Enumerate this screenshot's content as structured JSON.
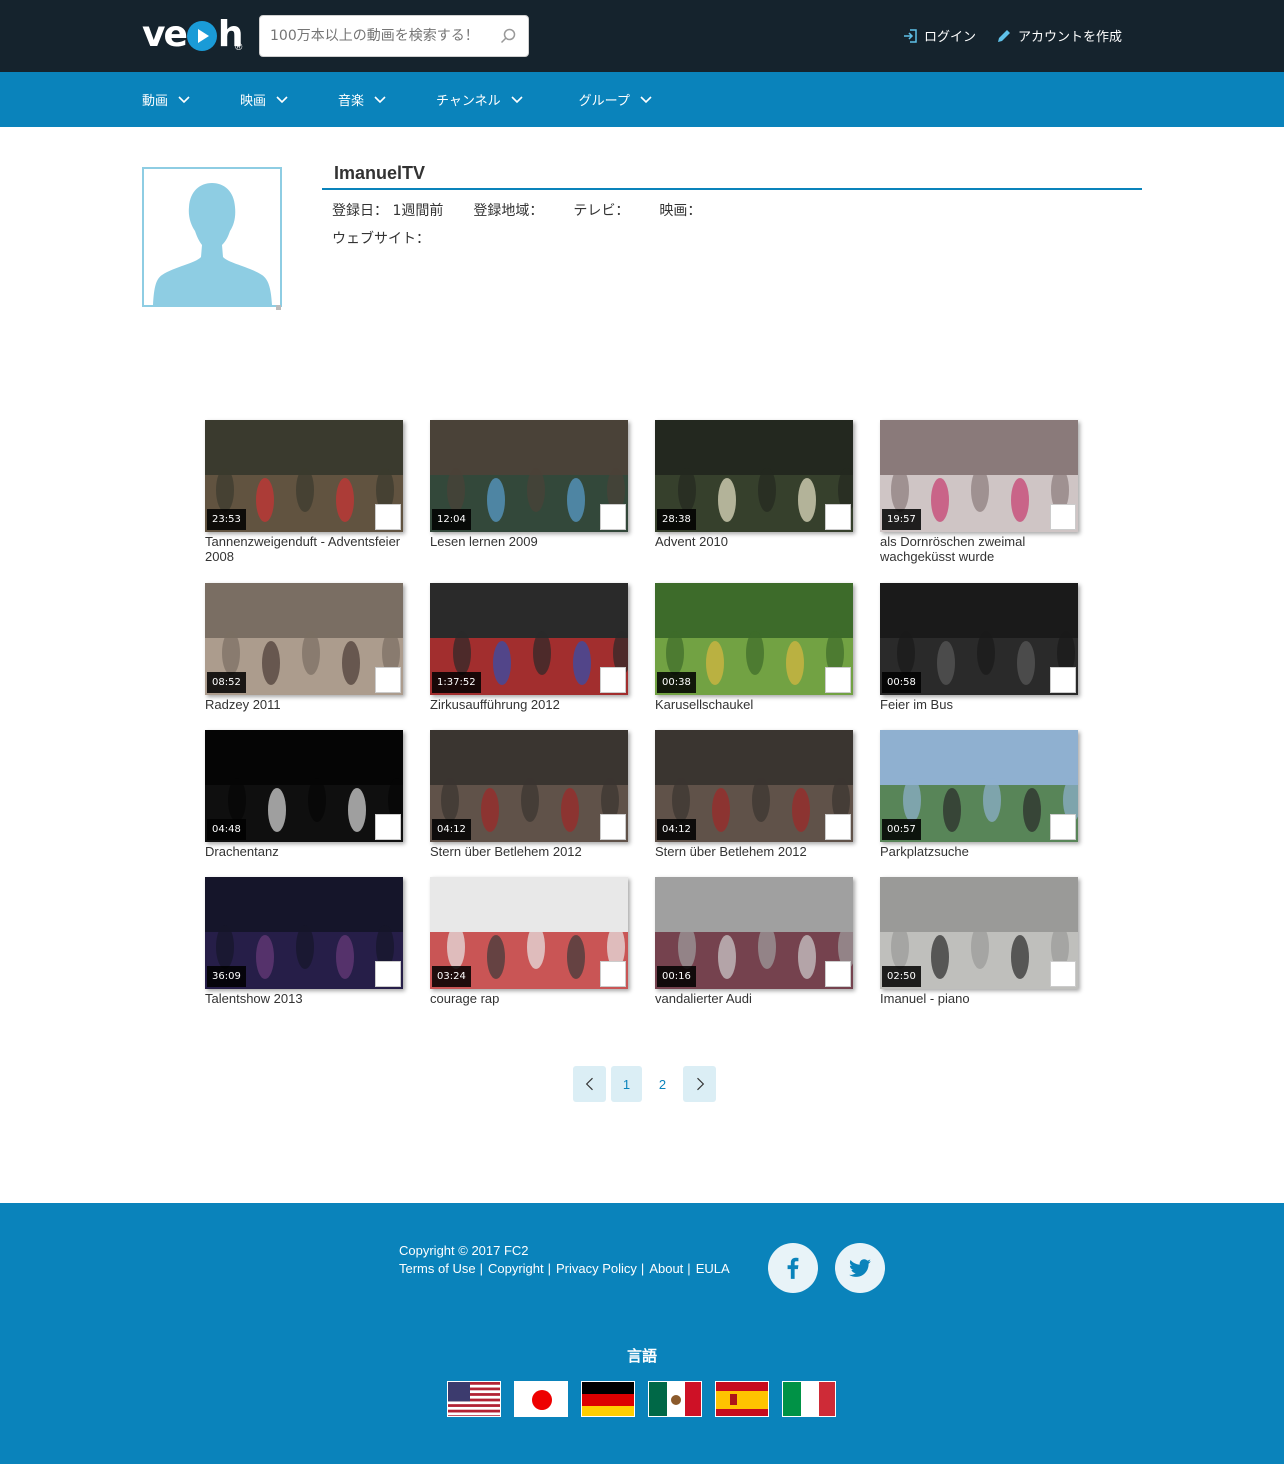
{
  "header": {
    "logo": "veoh",
    "logo_reg": "®",
    "search_placeholder": "100万本以上の動画を検索する！",
    "login_label": "ログイン",
    "signup_label": "アカウントを作成"
  },
  "nav": {
    "items": [
      {
        "label": "動画"
      },
      {
        "label": "映画"
      },
      {
        "label": "音楽"
      },
      {
        "label": "チャンネル"
      },
      {
        "label": "グループ"
      }
    ]
  },
  "profile": {
    "name": "ImanuelTV",
    "registered": "登録日： 1週間前",
    "region": "登録地域：",
    "tv": "テレビ：",
    "movies": "映画：",
    "website": "ウェブサイト："
  },
  "videos": [
    {
      "title": "Tannenzweigenduft - Adventsfeier 2008",
      "duration": "23:53",
      "palette": [
        "#3a3a2e",
        "#6b5a45",
        "#c33"
      ]
    },
    {
      "title": "Lesen lernen 2009",
      "duration": "12:04",
      "palette": [
        "#4a4238",
        "#2d4a3b",
        "#5aa0d0"
      ]
    },
    {
      "title": "Advent 2010",
      "duration": "28:38",
      "palette": [
        "#23281f",
        "#3b4630",
        "#e8e4c8"
      ]
    },
    {
      "title": "als Dornröschen zweimal wachgeküsst wurde",
      "duration": "19:57",
      "palette": [
        "#8a7a7a",
        "#e0d8d8",
        "#c63a6e"
      ]
    },
    {
      "title": "Radzey 2011",
      "duration": "08:52",
      "palette": [
        "#7a6e63",
        "#b9a897",
        "#4a3b35"
      ]
    },
    {
      "title": "Zirkusaufführung 2012",
      "duration": "1:37:52",
      "palette": [
        "#2a2a2a",
        "#c03030",
        "#3050b0"
      ]
    },
    {
      "title": "Karusellschaukel",
      "duration": "00:38",
      "palette": [
        "#3d6b2a",
        "#7fb04a",
        "#d8b840"
      ]
    },
    {
      "title": "Feier im Bus",
      "duration": "00:58",
      "palette": [
        "#1a1a1a",
        "#2e2e2e",
        "#5a5a5a"
      ]
    },
    {
      "title": "Drachentanz",
      "duration": "04:48",
      "palette": [
        "#050505",
        "#111",
        "#ddd"
      ]
    },
    {
      "title": "Stern über Betlehem 2012",
      "duration": "04:12",
      "palette": [
        "#3a3530",
        "#6a5a50",
        "#a02828"
      ]
    },
    {
      "title": "Stern über Betlehem 2012",
      "duration": "04:12",
      "palette": [
        "#3a3530",
        "#6a5a50",
        "#a02828"
      ]
    },
    {
      "title": "Parkplatzsuche",
      "duration": "00:57",
      "palette": [
        "#8fb0d0",
        "#4a7a3a",
        "#2a2a2a"
      ]
    },
    {
      "title": "Talentshow 2013",
      "duration": "36:09",
      "palette": [
        "#15152a",
        "#2a2050",
        "#6a3a7a"
      ]
    },
    {
      "title": "courage rap",
      "duration": "03:24",
      "palette": [
        "#e8e8e8",
        "#c03030",
        "#3a3a3a"
      ]
    },
    {
      "title": "vandalierter Audi",
      "duration": "00:16",
      "palette": [
        "#a0a0a0",
        "#6a2a3a",
        "#cfcfcf"
      ]
    },
    {
      "title": "Imanuel - piano",
      "duration": "02:50",
      "palette": [
        "#9a9a98",
        "#c8c8c6",
        "#2a2a2a"
      ]
    }
  ],
  "add_icon": "",
  "pagination": {
    "prev_icon": "chevron-left-icon",
    "pages": [
      "1",
      "2"
    ],
    "current": "1",
    "next_icon": "chevron-right-icon"
  },
  "footer": {
    "copyright": "Copyright © 2017 FC2",
    "links": [
      "Terms of Use",
      "Copyright",
      "Privacy Policy",
      "About",
      "EULA"
    ],
    "language_title": "言語",
    "languages": [
      "us",
      "jp",
      "de",
      "mx",
      "es",
      "it"
    ]
  },
  "colors": {
    "header_bg": "#15232d",
    "nav_bg": "#0a83bb",
    "footer_bg": "#0a83bb",
    "accent": "#1a9bd7",
    "avatar": "#8ecde3"
  }
}
